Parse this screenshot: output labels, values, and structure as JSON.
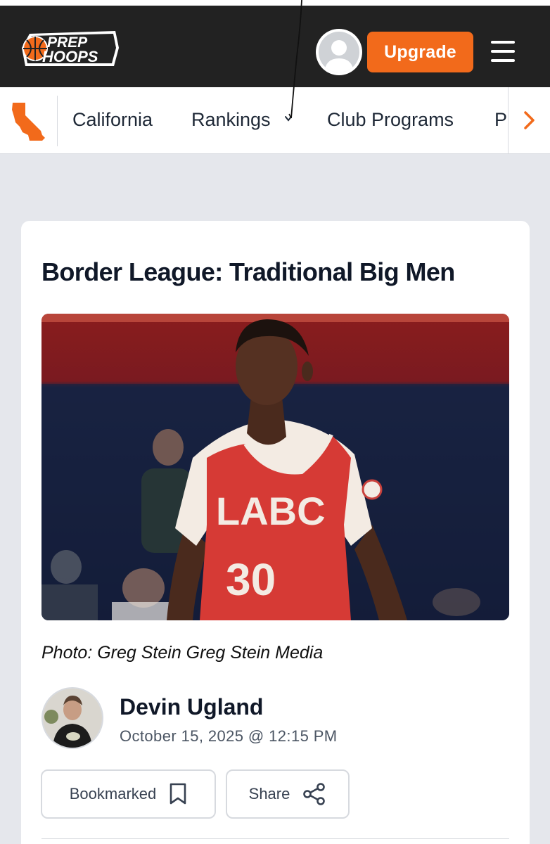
{
  "header": {
    "logo_line1": "PREP",
    "logo_line2": "HOOPS",
    "upgrade_label": "Upgrade"
  },
  "subnav": {
    "items": [
      {
        "label": "California"
      },
      {
        "label": "Rankings"
      },
      {
        "label": "Club Programs"
      },
      {
        "label": "P"
      }
    ],
    "rankings_chevron": "⌄"
  },
  "article": {
    "title": "Border League: Traditional Big Men",
    "photo_caption": "Photo: Greg Stein Greg Stein Media",
    "jersey_text": "LABC",
    "jersey_number": "30",
    "author_name": "Devin Ugland",
    "published": "October 15, 2025 @ 12:15 PM"
  },
  "actions": {
    "bookmark_label": "Bookmarked",
    "share_label": "Share"
  },
  "colors": {
    "brand_orange": "#f26a1b",
    "header_bg": "#222222",
    "page_bg": "#e5e7ec"
  },
  "icons": {
    "logo": "basketball-logo-icon",
    "state": "california-state-icon",
    "menu": "hamburger-menu-icon",
    "scroll": "chevron-right-icon",
    "bookmark": "bookmark-icon",
    "share": "share-icon"
  }
}
